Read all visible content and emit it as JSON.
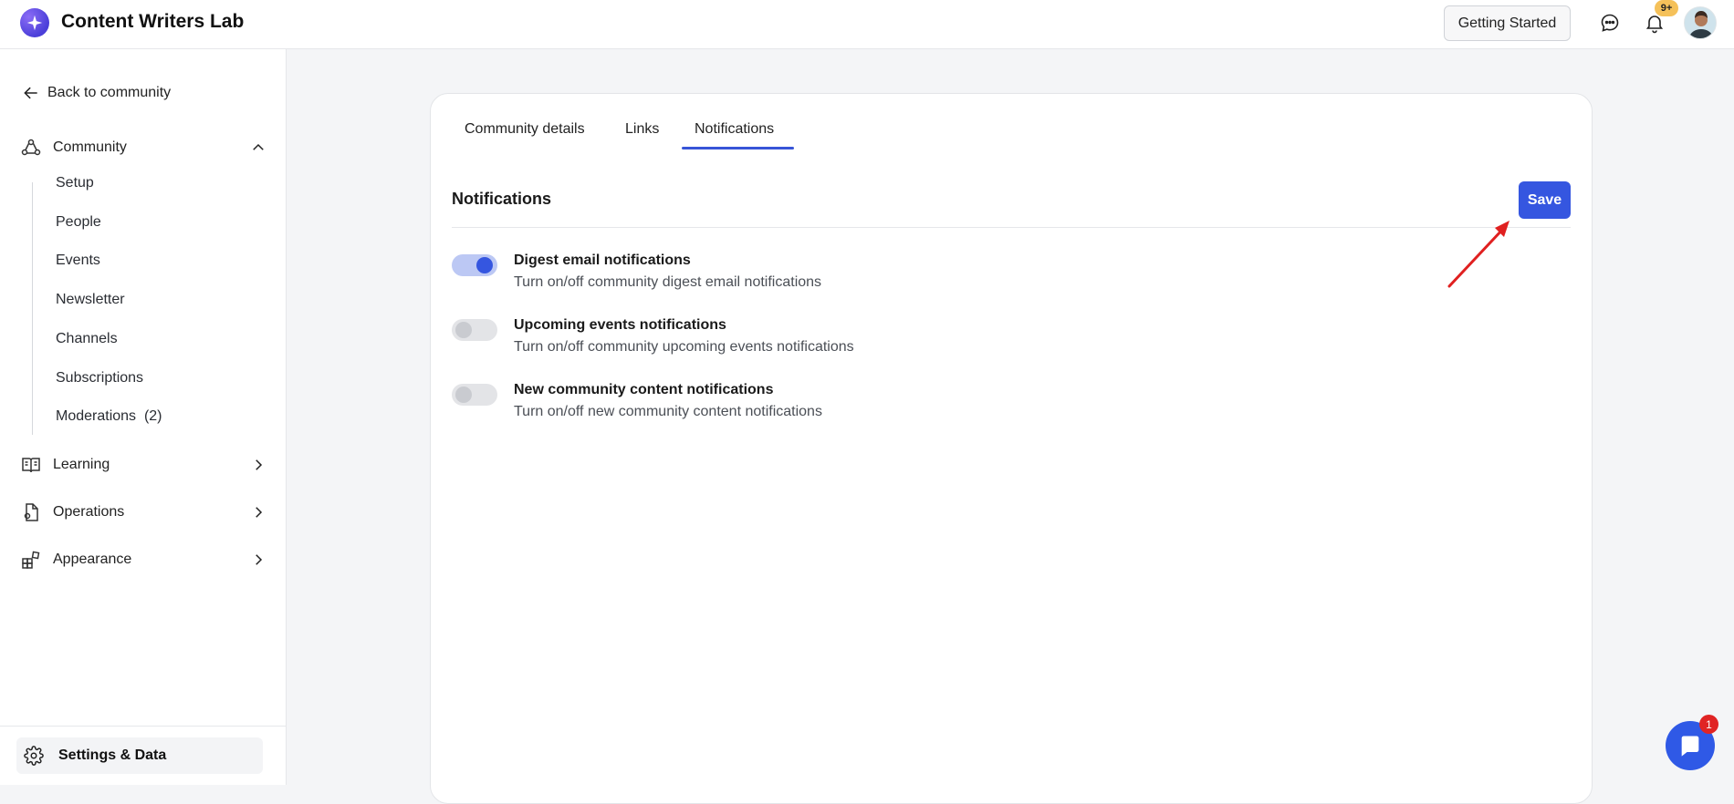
{
  "app": {
    "title": "Content Writers Lab",
    "logo_icon": "sparkle-icon",
    "brand_color": "#3556e0"
  },
  "topbar": {
    "getting_started_label": "Getting Started",
    "chat_icon": "chat-bubble-icon",
    "bell_icon": "bell-icon",
    "notification_badge": "9+"
  },
  "sidebar": {
    "back_label": "Back to community",
    "sections": [
      {
        "label": "Community",
        "icon": "community-icon",
        "expanded": true
      },
      {
        "label": "Learning",
        "icon": "book-icon",
        "expanded": false
      },
      {
        "label": "Operations",
        "icon": "document-icon",
        "expanded": false
      },
      {
        "label": "Appearance",
        "icon": "shapes-icon",
        "expanded": false
      }
    ],
    "community_items": [
      {
        "label": "Setup"
      },
      {
        "label": "People"
      },
      {
        "label": "Events"
      },
      {
        "label": "Newsletter"
      },
      {
        "label": "Channels"
      },
      {
        "label": "Subscriptions"
      },
      {
        "label": "Moderations  (2)"
      }
    ],
    "settings_label": "Settings & Data"
  },
  "main": {
    "tabs": [
      {
        "label": "Community details",
        "active": false
      },
      {
        "label": "Links",
        "active": false
      },
      {
        "label": "Notifications",
        "active": true
      }
    ],
    "section_title": "Notifications",
    "save_label": "Save",
    "notifications": [
      {
        "title": "Digest email notifications",
        "description": "Turn on/off community digest email notifications",
        "enabled": true
      },
      {
        "title": "Upcoming events notifications",
        "description": "Turn on/off community upcoming events notifications",
        "enabled": false
      },
      {
        "title": "New community content notifications",
        "description": "Turn on/off new community content notifications",
        "enabled": false
      }
    ]
  },
  "chat_widget": {
    "badge": "1"
  }
}
